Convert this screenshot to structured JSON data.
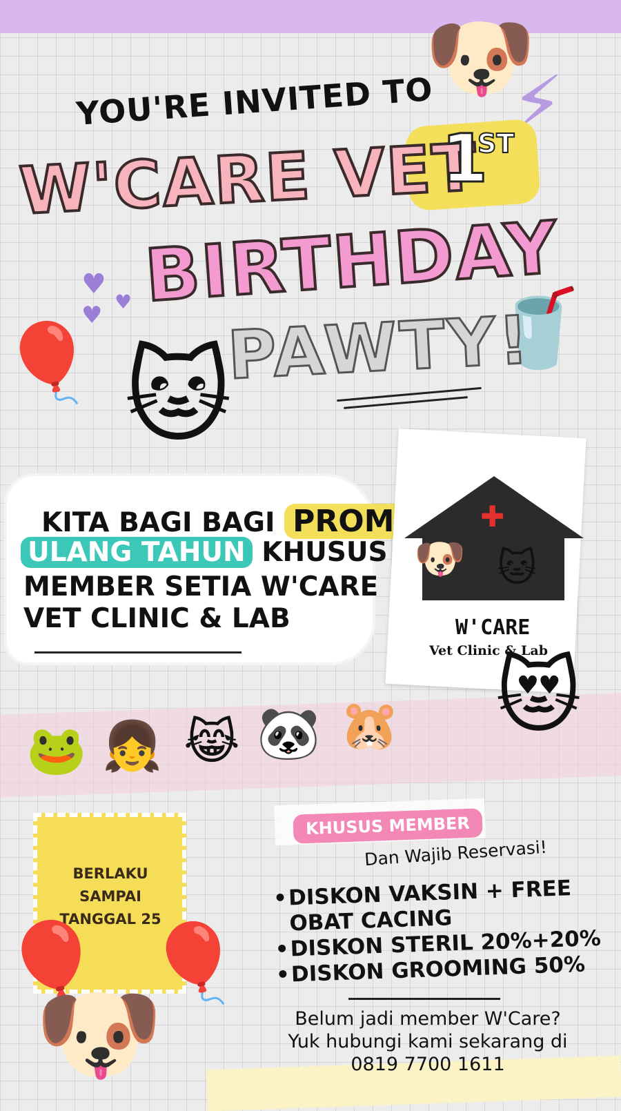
{
  "header": {
    "invited": "YOU'RE INVITED TO",
    "title_line1": "W'CARE VET",
    "ordinal_number": "1",
    "ordinal_suffix": "ST",
    "title_line2": "BIRTHDAY",
    "title_line3": "PAWTY!"
  },
  "promo": {
    "line1_prefix": "KITA BAGI BAGI",
    "line1_highlight": "PROMO",
    "line2_highlight": "ULANG TAHUN",
    "line2_suffix": "KHUSUS",
    "line3": "MEMBER SETIA W'CARE",
    "line4": "VET CLINIC & LAB"
  },
  "logo": {
    "brand": "W'CARE",
    "subtitle": "Vet Clinic & Lab"
  },
  "validity": {
    "line1": "BERLAKU",
    "line2": "SAMPAI",
    "line3": "TANGGAL 25"
  },
  "offer": {
    "badge": "KHUSUS MEMBER",
    "note": "Dan Wajib Reservasi!",
    "bullet_marker": "•",
    "items": [
      {
        "line1": "DISKON VAKSIN + FREE",
        "line2": "OBAT CACING"
      },
      {
        "line1": "DISKON STERIL 20%+20%"
      },
      {
        "line1": "DISKON GROOMING 50%"
      }
    ]
  },
  "contact": {
    "line1": "Belum jadi member W'Care?",
    "line2": "Yuk hubungi kami sekarang di",
    "phone": "0819 7700 1611"
  },
  "icons": {
    "puppy_top": "dog-face-icon",
    "lightning": "lightning-icon",
    "balloon_yellow": "balloon-icon",
    "cat_mascot": "cat-face-icon",
    "drink": "bubble-tea-icon",
    "hearts": "heart-icon",
    "stickers": [
      "frog-icon",
      "girl-face-icon",
      "cat-face-icon",
      "panda-icon",
      "hamster-icon"
    ],
    "cat_heart": "cat-hug-heart-icon",
    "puppy_bottom": "dog-face-icon"
  },
  "colors": {
    "accent_yellow": "#f3df5a",
    "accent_pink": "#f388b7",
    "accent_teal": "#3cc8b8",
    "accent_purple": "#d9b8ee"
  }
}
